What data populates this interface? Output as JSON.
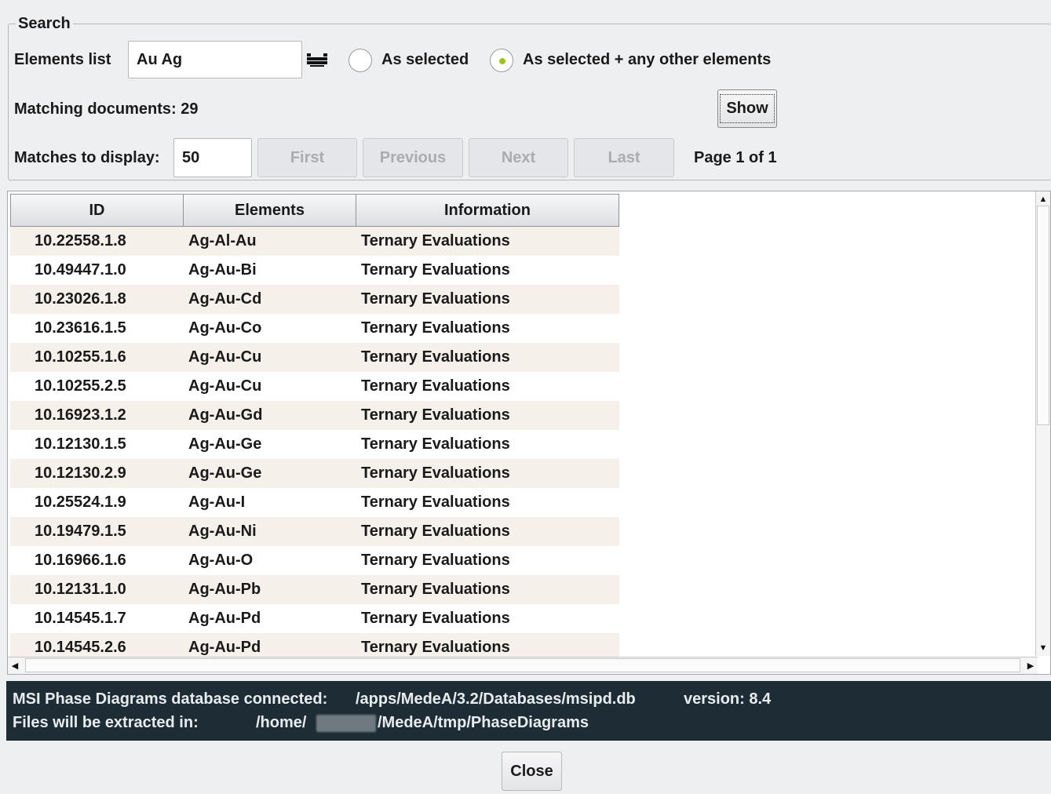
{
  "search": {
    "legend": "Search",
    "elements_label": "Elements list",
    "elements_value": "Au Ag",
    "radio_as_selected": "As selected",
    "radio_as_selected_plus": "As selected + any other elements",
    "selected_radio": "As selected + any other elements",
    "matching_label": "Matching documents: 29",
    "show_button": "Show",
    "matches_label": "Matches to display:",
    "matches_value": "50",
    "first_button": "First",
    "previous_button": "Previous",
    "next_button": "Next",
    "last_button": "Last",
    "page_info": "Page 1 of 1"
  },
  "table": {
    "columns": [
      "ID",
      "Elements",
      "Information"
    ],
    "rows": [
      [
        "10.22558.1.8",
        "Ag-Al-Au",
        "Ternary Evaluations"
      ],
      [
        "10.49447.1.0",
        "Ag-Au-Bi",
        "Ternary Evaluations"
      ],
      [
        "10.23026.1.8",
        "Ag-Au-Cd",
        "Ternary Evaluations"
      ],
      [
        "10.23616.1.5",
        "Ag-Au-Co",
        "Ternary Evaluations"
      ],
      [
        "10.10255.1.6",
        "Ag-Au-Cu",
        "Ternary Evaluations"
      ],
      [
        "10.10255.2.5",
        "Ag-Au-Cu",
        "Ternary Evaluations"
      ],
      [
        "10.16923.1.2",
        "Ag-Au-Gd",
        "Ternary Evaluations"
      ],
      [
        "10.12130.1.5",
        "Ag-Au-Ge",
        "Ternary Evaluations"
      ],
      [
        "10.12130.2.9",
        "Ag-Au-Ge",
        "Ternary Evaluations"
      ],
      [
        "10.25524.1.9",
        "Ag-Au-I",
        "Ternary Evaluations"
      ],
      [
        "10.19479.1.5",
        "Ag-Au-Ni",
        "Ternary Evaluations"
      ],
      [
        "10.16966.1.6",
        "Ag-Au-O",
        "Ternary Evaluations"
      ],
      [
        "10.12131.1.0",
        "Ag-Au-Pb",
        "Ternary Evaluations"
      ],
      [
        "10.14545.1.7",
        "Ag-Au-Pd",
        "Ternary Evaluations"
      ],
      [
        "10.14545.2.6",
        "Ag-Au-Pd",
        "Ternary Evaluations"
      ]
    ]
  },
  "status": {
    "db_label": "MSI Phase Diagrams database connected:",
    "db_path": "/apps/MedeA/3.2/Databases/msipd.db",
    "db_version": "version: 8.4",
    "extract_label": "Files will be extracted in:",
    "extract_path_prefix": "/home/",
    "extract_path_suffix": "/MedeA/tmp/PhaseDiagrams"
  },
  "footer": {
    "close_button": "Close"
  },
  "colors": {
    "row_alt": "#f5f0ea",
    "status_bg": "#1e2d35",
    "radio_dot": "#9cc322"
  }
}
